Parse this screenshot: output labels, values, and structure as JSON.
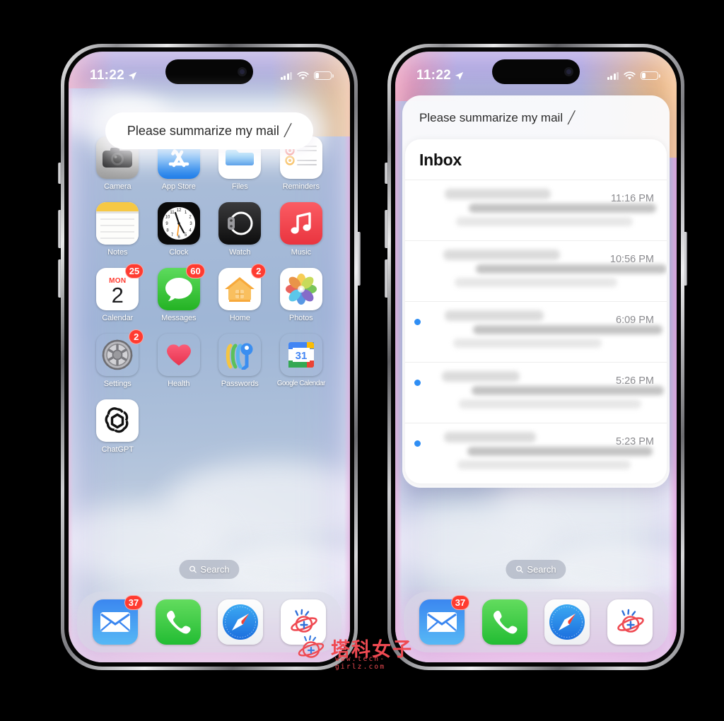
{
  "status_bar": {
    "time": "11:22",
    "location_icon": "location-arrow-icon",
    "cellular_icon": "signal-bars-icon",
    "wifi_icon": "wifi-icon",
    "battery_icon": "battery-icon",
    "battery_level_pct": 22
  },
  "siri": {
    "query": "Please summarize my mail",
    "edit_glyph": "╱"
  },
  "home_screen": {
    "apps": [
      {
        "name": "Camera",
        "icon": "camera-icon",
        "badge": null
      },
      {
        "name": "App Store",
        "icon": "app-store-icon",
        "badge": null
      },
      {
        "name": "Files",
        "icon": "files-icon",
        "badge": null
      },
      {
        "name": "Reminders",
        "icon": "reminders-icon",
        "badge": null
      },
      {
        "name": "Notes",
        "icon": "notes-icon",
        "badge": null
      },
      {
        "name": "Clock",
        "icon": "clock-icon",
        "badge": null
      },
      {
        "name": "Watch",
        "icon": "watch-icon",
        "badge": null
      },
      {
        "name": "Music",
        "icon": "music-icon",
        "badge": null
      },
      {
        "name": "Calendar",
        "icon": "calendar-icon",
        "badge": "25",
        "weekday": "MON",
        "day": "2"
      },
      {
        "name": "Messages",
        "icon": "messages-icon",
        "badge": "60"
      },
      {
        "name": "Home",
        "icon": "home-icon",
        "badge": "2"
      },
      {
        "name": "Photos",
        "icon": "photos-icon",
        "badge": null
      },
      {
        "name": "Settings",
        "icon": "settings-gear-icon",
        "badge": "2"
      },
      {
        "name": "Health",
        "icon": "health-heart-icon",
        "badge": null
      },
      {
        "name": "Passwords",
        "icon": "passwords-key-icon",
        "badge": null
      },
      {
        "name": "Google Calendar",
        "icon": "google-calendar-icon",
        "badge": null,
        "day": "31"
      },
      {
        "name": "ChatGPT",
        "icon": "chatgpt-icon",
        "badge": null
      }
    ],
    "search": {
      "label": "Search",
      "icon": "search-icon"
    },
    "dock": [
      {
        "name": "Mail",
        "icon": "mail-envelope-icon",
        "badge": "37"
      },
      {
        "name": "Phone",
        "icon": "phone-handset-icon",
        "badge": null
      },
      {
        "name": "Safari",
        "icon": "safari-compass-icon",
        "badge": null
      },
      {
        "name": "Planet",
        "icon": "planet-icon",
        "badge": null
      }
    ]
  },
  "mail_panel": {
    "title": "Inbox",
    "rows": [
      {
        "time": "11:16 PM",
        "unread": false
      },
      {
        "time": "10:56 PM",
        "unread": false
      },
      {
        "time": "6:09 PM",
        "unread": true
      },
      {
        "time": "5:26 PM",
        "unread": true
      },
      {
        "time": "5:23 PM",
        "unread": true
      }
    ]
  },
  "watermark": {
    "text": "塔科女子",
    "url": "www.tech-girlz.com",
    "icon": "planet-icon",
    "color": "#ef4a52"
  },
  "colors": {
    "badge_red": "#ff3b30",
    "unread_blue": "#2f8ef4",
    "accent_purple": "#a890de"
  }
}
